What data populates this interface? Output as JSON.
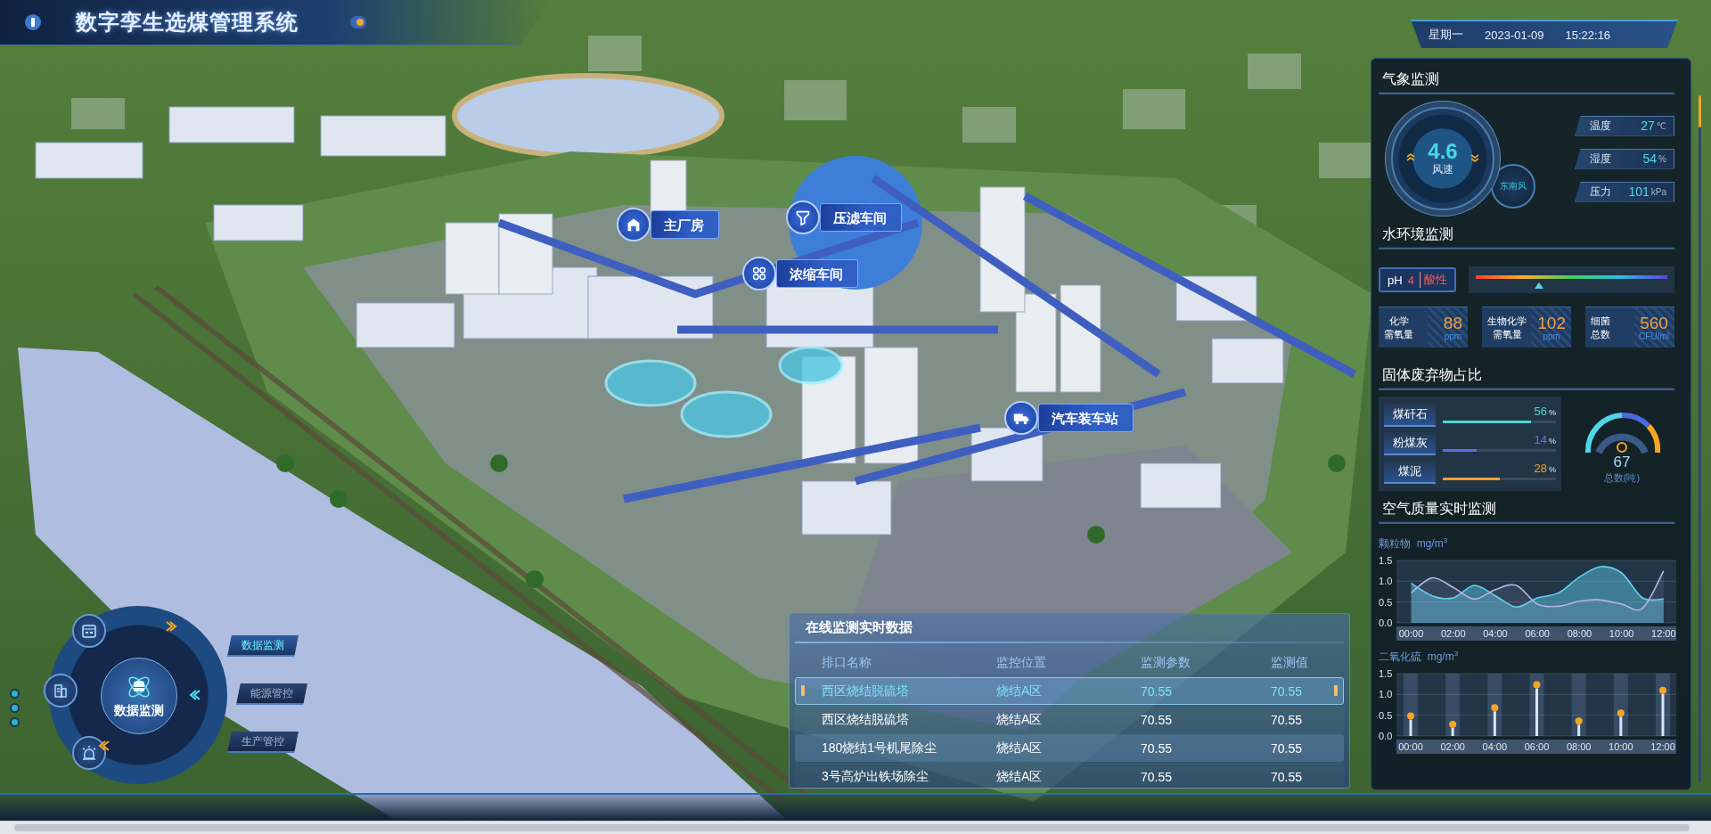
{
  "header": {
    "title": "数字孪生选煤管理系统"
  },
  "datetime": {
    "weekday": "星期一",
    "date": "2023-01-09",
    "time": "15:22:16"
  },
  "map_labels": [
    {
      "label": "主厂房"
    },
    {
      "label": "压滤车间"
    },
    {
      "label": "浓缩车间"
    },
    {
      "label": "汽车装车站"
    }
  ],
  "nav": {
    "center_label": "数据监测",
    "buttons": [
      {
        "label": "数据监测",
        "selected": true
      },
      {
        "label": "能源管控",
        "selected": false
      },
      {
        "label": "生产管控",
        "selected": false
      }
    ]
  },
  "table": {
    "title": "在线监测实时数据",
    "columns": [
      "排口名称",
      "监控位置",
      "监测参数",
      "监测值"
    ],
    "rows": [
      {
        "cells": [
          "西区烧结脱硫塔",
          "烧结A区",
          "70.55",
          "70.55"
        ],
        "selected": true
      },
      {
        "cells": [
          "西区烧结脱硫塔",
          "烧结A区",
          "70.55",
          "70.55"
        ],
        "selected": false
      },
      {
        "cells": [
          "180烧结1号机尾除尘",
          "烧结A区",
          "70.55",
          "70.55"
        ],
        "selected": false
      },
      {
        "cells": [
          "3号高炉出铁场除尘",
          "烧结A区",
          "70.55",
          "70.55"
        ],
        "selected": false
      }
    ]
  },
  "weather": {
    "title": "气象监测",
    "wind_speed": "4.6",
    "wind_label": "风速",
    "wind_direction": "东南风",
    "stats": [
      {
        "label": "温度",
        "value": "27",
        "unit": "℃"
      },
      {
        "label": "湿度",
        "value": "54",
        "unit": "%"
      },
      {
        "label": "压力",
        "value": "101",
        "unit": "kPa"
      }
    ]
  },
  "water": {
    "title": "水环境监测",
    "ph": {
      "label": "pH",
      "value": "4",
      "status": "酸性",
      "level": 0.33
    },
    "cards": [
      {
        "label_lines": [
          "化学",
          "需氧量"
        ],
        "value": "88",
        "unit": "ppm"
      },
      {
        "label_lines": [
          "生物化学",
          "需氧量"
        ],
        "value": "102",
        "unit": "ppm"
      },
      {
        "label_lines": [
          "细菌",
          "总数"
        ],
        "value": "560",
        "unit": "CFU/ml"
      }
    ]
  },
  "solid_waste": {
    "title": "固体废弃物占比",
    "items": [
      {
        "label": "煤矸石",
        "percent": "56",
        "unit": "%",
        "level": 0.78,
        "color": "#4fd6d0"
      },
      {
        "label": "粉煤灰",
        "percent": "14",
        "unit": "%",
        "level": 0.3,
        "color": "#5b6fe0"
      },
      {
        "label": "煤泥",
        "percent": "28",
        "unit": "%",
        "level": 0.5,
        "color": "#f0a030"
      }
    ],
    "total": "67",
    "total_label": "总数(吨)"
  },
  "air": {
    "title": "空气质量实时监测",
    "charts": [
      {
        "label": "颗粒物",
        "unit": "mg/m$^{3}$",
        "chart_data": {
          "type": "area",
          "x": [
            0,
            1,
            2,
            3,
            4,
            5,
            6,
            7,
            8,
            9,
            10,
            11,
            12
          ],
          "xlim": [
            -0.7,
            12.6
          ],
          "grid": true,
          "xticks": [
            {
              "value": 0,
              "label": "00:00"
            },
            {
              "value": 2,
              "label": "02:00"
            },
            {
              "value": 4,
              "label": "04:00"
            },
            {
              "value": 6,
              "label": "06:00"
            },
            {
              "value": 8,
              "label": "08:00"
            },
            {
              "value": 10,
              "label": "10:00"
            },
            {
              "value": 12,
              "label": "12:00"
            }
          ],
          "ylim": [
            0,
            1.5
          ],
          "yticks": [
            {
              "value": 0,
              "label": "0.0"
            },
            {
              "value": 0.5,
              "label": "0.5"
            },
            {
              "value": 1,
              "label": "1.0"
            },
            {
              "value": 1.5,
              "label": "1.5"
            }
          ],
          "series": [
            {
              "color": "#5fd3f0",
              "values": [
                0.95,
                0.65,
                0.6,
                0.9,
                0.65,
                0.38,
                0.6,
                0.72,
                1.1,
                1.35,
                1.2,
                0.6,
                0.57
              ]
            },
            {
              "color": "#b7b2e8",
              "values": [
                0.72,
                1.08,
                0.85,
                0.57,
                0.8,
                0.9,
                0.45,
                0.4,
                0.52,
                0.55,
                0.45,
                0.35,
                1.25
              ]
            }
          ]
        }
      },
      {
        "label": "二氧化硫",
        "unit": "mg/m$^{3}$",
        "chart_data": {
          "type": "scatter",
          "grid": true,
          "categories": [
            "00:00",
            "02:00",
            "04:00",
            "06:00",
            "08:00",
            "10:00",
            "12:00"
          ],
          "values": [
            0.48,
            0.28,
            0.68,
            1.23,
            0.36,
            0.55,
            1.1
          ],
          "ylim": [
            0,
            1.5
          ],
          "yticks": [
            {
              "value": 0,
              "label": "0.0"
            },
            {
              "value": 0.5,
              "label": "0.5"
            },
            {
              "value": 1,
              "label": "1.0"
            },
            {
              "value": 1.5,
              "label": "1.5"
            }
          ]
        }
      }
    ]
  }
}
